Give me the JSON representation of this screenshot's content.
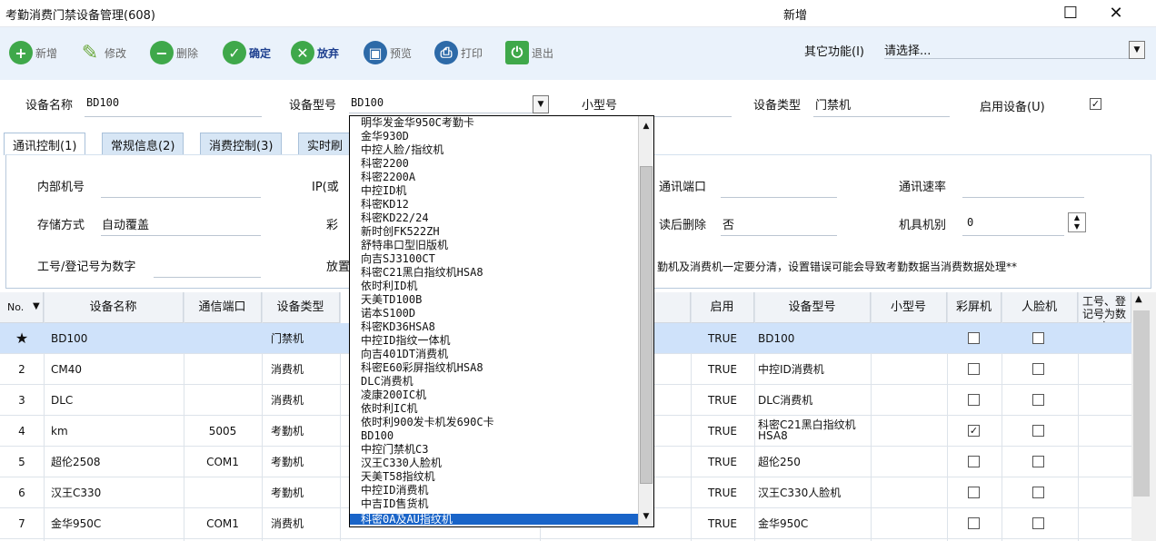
{
  "window": {
    "title": "考勤消费门禁设备管理(608)",
    "mode": "新增",
    "maximize_glyph": "☐",
    "close_glyph": "✕"
  },
  "toolbar": {
    "buttons": [
      {
        "label": "新增",
        "icon": "plus-icon",
        "color": "#3fa84a"
      },
      {
        "label": "修改",
        "icon": "pencil-icon",
        "color": "#6aa83a"
      },
      {
        "label": "删除",
        "icon": "minus-icon",
        "color": "#3fa84a"
      },
      {
        "label": "确定",
        "icon": "check-icon",
        "color": "#3fa84a"
      },
      {
        "label": "放弃",
        "icon": "cancel-icon",
        "color": "#3fa84a"
      },
      {
        "label": "预览",
        "icon": "preview-icon",
        "color": "#2d6aa8"
      },
      {
        "label": "打印",
        "icon": "print-icon",
        "color": "#2d6aa8"
      },
      {
        "label": "退出",
        "icon": "exit-icon",
        "color": "#3fa84a"
      }
    ],
    "other_label": "其它功能(I)",
    "other_value": "请选择..."
  },
  "form": {
    "name_label": "设备名称",
    "name_value": "BD100",
    "model_label": "设备型号",
    "model_value": "BD100",
    "submodel_label": "小型号",
    "type_label": "设备类型",
    "type_value": "门禁机",
    "enable_label": "启用设备(U)"
  },
  "tabs": [
    "通讯控制(1)",
    "常规信息(2)",
    "消费控制(3)",
    "实时刷"
  ],
  "panel": {
    "internal_no": "内部机号",
    "ip": "IP(或",
    "port": "通讯端口",
    "baud": "通讯速率",
    "storage": "存储方式",
    "storage_value": "自动覆盖",
    "color": "彩",
    "delete_after": "读后删除",
    "delete_value": "否",
    "machine_type": "机具机别",
    "machine_value": "0",
    "job_no": "工号/登记号为数字",
    "place": "放置",
    "warning": "勤机及消费机一定要分清，设置错误可能会导致考勤数据当消费数据处理**"
  },
  "grid": {
    "headers": [
      "No.",
      "设备名称",
      "通信端口",
      "设备类型",
      ")",
      "启用",
      "设备型号",
      "小型号",
      "彩屏机",
      "人脸机",
      "工号、登记号为数字"
    ],
    "rows": [
      {
        "no": "★",
        "name": "BD100",
        "port": "",
        "type": "门禁机",
        "enabled": "TRUE",
        "model": "BD100",
        "color": false,
        "face": false
      },
      {
        "no": "2",
        "name": "CM40",
        "port": "",
        "type": "消费机",
        "enabled": "TRUE",
        "model": "中控ID消费机",
        "color": false,
        "face": false
      },
      {
        "no": "3",
        "name": "DLC",
        "port": "",
        "type": "消费机",
        "enabled": "TRUE",
        "model": "DLC消费机",
        "color": false,
        "face": false
      },
      {
        "no": "4",
        "name": "km",
        "port": "5005",
        "type": "考勤机",
        "enabled": "TRUE",
        "model": "科密C21黑白指纹机HSA8",
        "color": true,
        "face": false
      },
      {
        "no": "5",
        "name": "超伦2508",
        "port": "COM1",
        "type": "考勤机",
        "enabled": "TRUE",
        "model": "超伦250",
        "color": false,
        "face": false
      },
      {
        "no": "6",
        "name": "汉王C330",
        "port": "",
        "type": "考勤机",
        "enabled": "TRUE",
        "model": "汉王C330人脸机",
        "color": false,
        "face": false
      },
      {
        "no": "7",
        "name": "金华950C",
        "port": "COM1",
        "type": "消费机",
        "enabled": "TRUE",
        "model": "金华950C",
        "color": false,
        "face": false
      }
    ]
  },
  "dropdown": {
    "items": [
      "明华发金华950C考勤卡",
      "金华930D",
      "中控人脸/指纹机",
      "科密2200",
      "科密2200A",
      "中控ID机",
      "科密KD12",
      "科密KD22/24",
      "新时创FK522ZH",
      "舒特串口型旧版机",
      "向吉SJ3100CT",
      "科密C21黑白指纹机HSA8",
      "依时利ID机",
      "天美TD100B",
      "诺本S100D",
      "科密KD36HSA8",
      "中控ID指纹一体机",
      "向吉401DT消费机",
      "科密E60彩屏指纹机HSA8",
      "DLC消费机",
      "凌康200IC机",
      "依时利IC机",
      "依时利900发卡机发690C卡",
      "BD100",
      "中控门禁机C3",
      "汉王C330人脸机",
      "天美T58指纹机",
      "中控ID消费机",
      "中吉ID售货机",
      "科密0A及AU指纹机"
    ],
    "highlighted": 29
  }
}
